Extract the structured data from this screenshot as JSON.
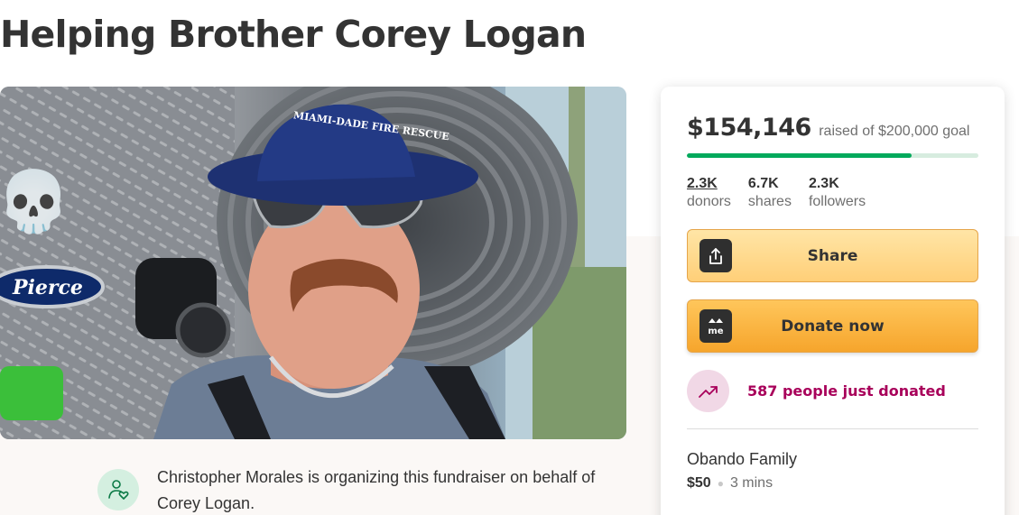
{
  "page": {
    "title": "Helping Brother Corey Logan"
  },
  "hero": {
    "hat_text": "MIAMI-DADE FIRE RESCUE",
    "truck_badge": "Pierce",
    "emoji": "💀"
  },
  "organizer": {
    "icon": "heart-hand-icon",
    "text": "Christopher Morales is organizing this fundraiser on behalf of Corey Logan."
  },
  "donation_card": {
    "raised_amount": "$154,146",
    "raised_goal_text": "raised of $200,000 goal",
    "progress_fraction": 0.77,
    "colors": {
      "progress": "#02a95c",
      "track": "#d7ecdf",
      "accent_pink": "#a8005a",
      "donate": "#f6a52c"
    },
    "stats": [
      {
        "value": "2.3K",
        "label": "donors"
      },
      {
        "value": "6.7K",
        "label": "shares"
      },
      {
        "value": "2.3K",
        "label": "followers"
      }
    ],
    "share_button": {
      "label": "Share",
      "icon": "share-upload-icon"
    },
    "donate_button": {
      "label": "Donate now",
      "icon": "gofundme-logo-icon",
      "icon_text": "me"
    },
    "recent_activity": {
      "text": "587 people just donated",
      "icon": "trending-up-icon"
    },
    "latest_donation": {
      "name": "Obando Family",
      "amount": "$50",
      "time": "3 mins"
    }
  }
}
